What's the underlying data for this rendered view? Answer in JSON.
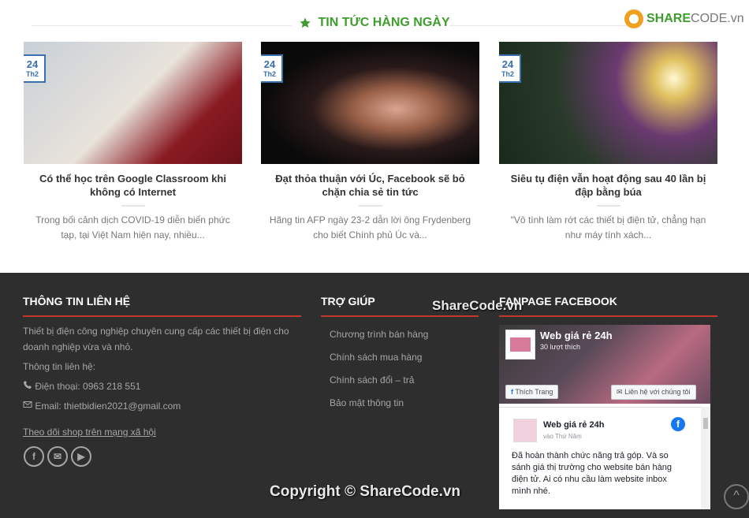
{
  "section": {
    "title": "TIN TỨC HÀNG NGÀY",
    "icon": "star-icon",
    "accent": "#3e9d2c"
  },
  "logo": {
    "brand": "SHARE",
    "suffix": "CODE.vn"
  },
  "posts": [
    {
      "day": "24",
      "month": "Th2",
      "title": "Có thể học trên Google Classroom khi không có Internet",
      "excerpt": "Trong bối cảnh dịch COVID-19 diễn biến phức tạp, tại Việt Nam hiện nay, nhiều..."
    },
    {
      "day": "24",
      "month": "Th2",
      "title": "Đạt thỏa thuận với Úc, Facebook sẽ bỏ chặn chia sẻ tin tức",
      "excerpt": "Hãng tin AFP ngày 23-2 dẫn lời ông Frydenberg cho biết Chính phủ Úc và..."
    },
    {
      "day": "24",
      "month": "Th2",
      "title": "Siêu tụ điện vẫn hoạt động sau 40 lần bị đập bằng búa",
      "excerpt": "\"Vô tình làm rớt các thiết bị điện tử, chẳng hạn như máy tính xách..."
    }
  ],
  "footer": {
    "contact": {
      "title": "THÔNG TIN LIÊN HỆ",
      "desc": "Thiết bị điện công nghiệp chuyên cung cấp các thiết bị điện cho doanh nghiệp vừa và nhỏ.",
      "info_label": "Thông tin liên hệ:",
      "phone": "Điện thoại: 0963 218 551",
      "email": "Email: thietbidien2021@gmail.com",
      "social_label": "Theo dõi shop trên mạng xã hội"
    },
    "help": {
      "title": "TRỢ GIÚP",
      "links": [
        "Chương trình bán hàng",
        "Chính sách mua hàng",
        "Chính sách đổi – trả",
        "Bảo mật thông tin"
      ]
    },
    "fanpage": {
      "title": "FANPAGE FACEBOOK",
      "page_name": "Web giá rẻ 24h",
      "likes": "30 lượt thích",
      "like_button": "Thích Trang",
      "message_button": "Liên hệ với chúng tôi",
      "post_author": "Web giá rẻ 24h",
      "post_time": "vào Thứ Năm",
      "post_text": "Đã hoàn thành chức năng trả góp. Và so sánh giá thị trường cho website bán hàng điện tử. Ai có nhu cầu làm website inbox mình nhé."
    },
    "accent": "#c0392b"
  },
  "watermarks": {
    "mid": "ShareCode.vn",
    "copyright": "Copyright © ShareCode.vn"
  }
}
